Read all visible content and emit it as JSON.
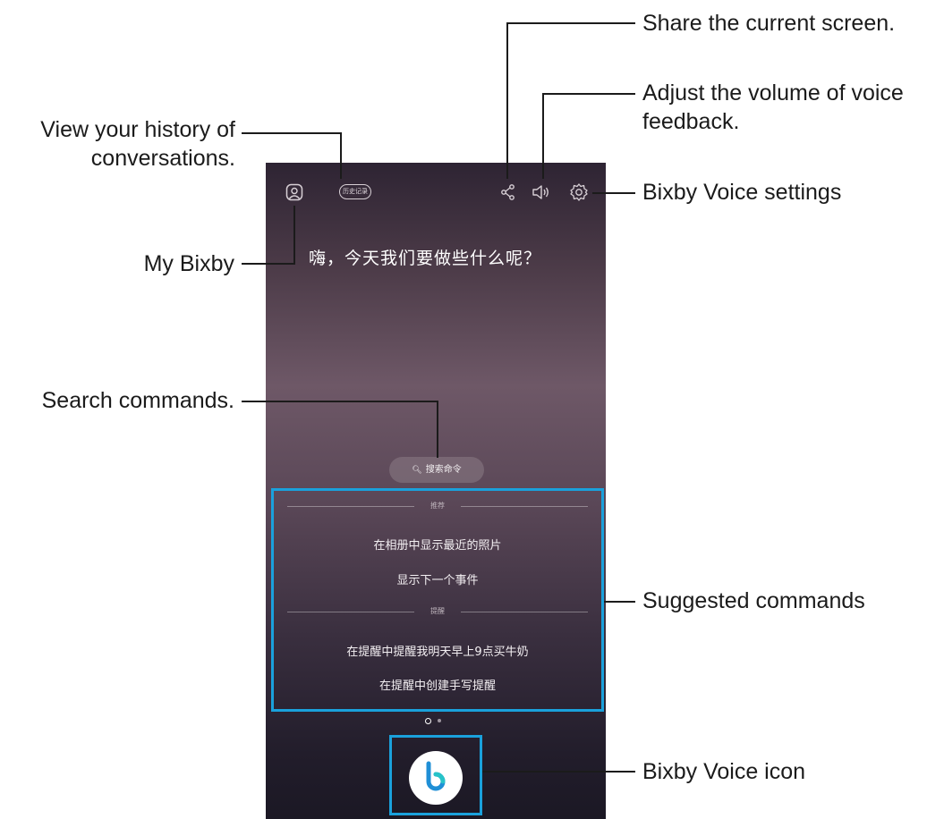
{
  "annotations": {
    "history": "View your history of conversations.",
    "my_bixby": "My Bixby",
    "search": "Search commands.",
    "share": "Share the current screen.",
    "volume": "Adjust the volume of voice feedback.",
    "settings": "Bixby Voice settings",
    "suggested": "Suggested commands",
    "bixby_icon": "Bixby Voice icon"
  },
  "screen": {
    "history_button": "历史记录",
    "greeting": "嗨，今天我们要做些什么呢？",
    "search_button": "搜索命令",
    "sections": [
      {
        "header": "推荐",
        "commands": [
          "在相册中显示最近的照片",
          "显示下一个事件"
        ]
      },
      {
        "header": "提醒",
        "commands": [
          "在提醒中提醒我明天早上9点买牛奶",
          "在提醒中创建手写提醒"
        ]
      }
    ],
    "page_indicator": {
      "current": 1,
      "total": 2
    }
  },
  "icons": [
    "my-bixby-icon",
    "share-icon",
    "volume-icon",
    "settings-gear-icon",
    "search-icon",
    "bixby-voice-icon"
  ],
  "colors": {
    "highlight": "#1aa1dc",
    "bixby_blue": "#1f8fd6",
    "bixby_teal": "#27c3c8"
  }
}
